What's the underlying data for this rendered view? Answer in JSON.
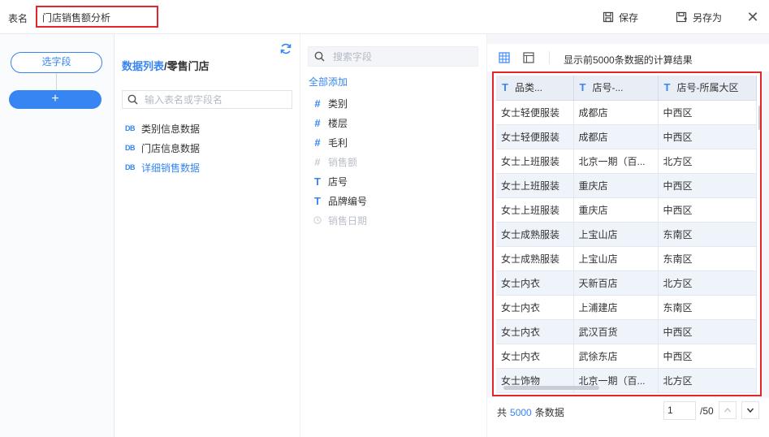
{
  "header": {
    "name_label": "表名",
    "name_value": "门店销售额分析",
    "save_label": "保存",
    "save_as_label": "另存为",
    "close_symbol": "✕"
  },
  "rail": {
    "select_field_label": "选字段",
    "add_symbol": "+"
  },
  "tables_panel": {
    "crumb_link": "数据列表",
    "crumb_sep": "/",
    "crumb_current": "零售门店",
    "search_placeholder": "输入表名或字段名",
    "items": [
      {
        "icon": "DB",
        "label": "类别信息数据"
      },
      {
        "icon": "DB",
        "label": "门店信息数据"
      },
      {
        "icon": "DB",
        "label": "详细销售数据"
      }
    ]
  },
  "fields_panel": {
    "search_placeholder": "搜索字段",
    "add_all_label": "全部添加",
    "items": [
      {
        "icon": "#",
        "label": "类别"
      },
      {
        "icon": "#",
        "label": "楼层"
      },
      {
        "icon": "#",
        "label": "毛利"
      },
      {
        "icon": "#",
        "label": "销售额"
      },
      {
        "icon": "T",
        "label": "店号"
      },
      {
        "icon": "T",
        "label": "品牌编号"
      },
      {
        "icon": "clock",
        "label": "销售日期"
      }
    ]
  },
  "preview": {
    "caption": "显示前5000条数据的计算结果",
    "columns": [
      {
        "type": "T",
        "label": "品类..."
      },
      {
        "type": "T",
        "label": "店号-..."
      },
      {
        "type": "T",
        "label": "店号-所属大区"
      }
    ],
    "rows": [
      [
        "女士轻便服装",
        "成都店",
        "中西区"
      ],
      [
        "女士轻便服装",
        "成都店",
        "中西区"
      ],
      [
        "女士上班服装",
        "北京一期（百...",
        "北方区"
      ],
      [
        "女士上班服装",
        "重庆店",
        "中西区"
      ],
      [
        "女士上班服装",
        "重庆店",
        "中西区"
      ],
      [
        "女士成熟服装",
        "上宝山店",
        "东南区"
      ],
      [
        "女士成熟服装",
        "上宝山店",
        "东南区"
      ],
      [
        "女士内衣",
        "天新百店",
        "北方区"
      ],
      [
        "女士内衣",
        "上浦建店",
        "东南区"
      ],
      [
        "女士内衣",
        "武汉百货",
        "中西区"
      ],
      [
        "女士内衣",
        "武徐东店",
        "中西区"
      ],
      [
        "女士饰物",
        "北京一期（百...",
        "北方区"
      ]
    ],
    "footer": {
      "count_prefix": "共",
      "count_value": "5000",
      "count_suffix": "条数据",
      "page_value": "1",
      "page_total": "/50"
    }
  },
  "colors": {
    "accent": "#3685f2",
    "highlight_border": "#e3262b"
  }
}
